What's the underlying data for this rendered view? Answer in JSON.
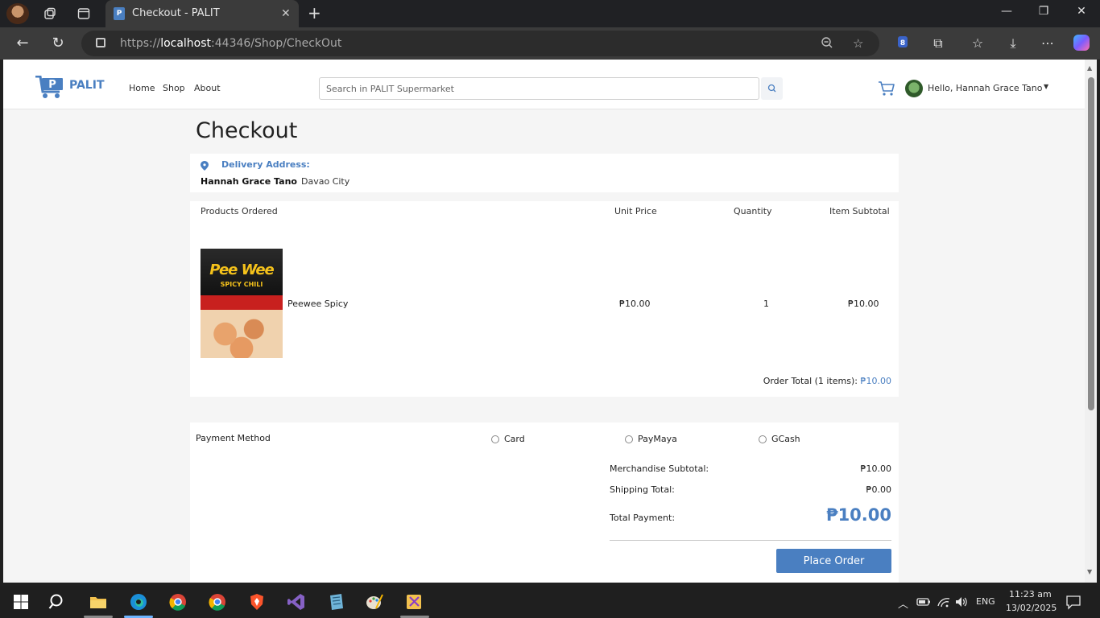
{
  "browser": {
    "tab_title": "Checkout - PALIT",
    "tab_favicon_letter": "P",
    "url_prefix": "https://",
    "url_host": "localhost",
    "url_rest": ":44346/Shop/CheckOut"
  },
  "site": {
    "logo_letter": "P",
    "logo_text": "PALIT",
    "nav": [
      "Home",
      "Shop",
      "About"
    ],
    "search_placeholder": "Search in PALIT Supermarket",
    "user_greeting": "Hello, Hannah Grace Tano",
    "brand_color": "#4a7fc1"
  },
  "checkout": {
    "title": "Checkout",
    "delivery": {
      "label": "Delivery Address:",
      "name": "Hannah Grace Tano",
      "city": "Davao City"
    },
    "columns": {
      "products": "Products Ordered",
      "unit_price": "Unit Price",
      "quantity": "Quantity",
      "subtotal": "Item Subtotal"
    },
    "item": {
      "name": "Peewee Spicy",
      "package_brand": "Pee Wee",
      "package_flavor": "SPICY CHILI",
      "unit_price": "₱10.00",
      "quantity": "1",
      "subtotal": "₱10.00"
    },
    "order_total_label": "Order Total (1 items):",
    "order_total_value": "₱10.00",
    "payment": {
      "label": "Payment Method",
      "options": [
        "Card",
        "PayMaya",
        "GCash"
      ]
    },
    "summary": {
      "merch_label": "Merchandise Subtotal:",
      "merch_value": "₱10.00",
      "ship_label": "Shipping Total:",
      "ship_value": "₱0.00",
      "total_label": "Total Payment:",
      "total_value": "₱10.00"
    },
    "place_order": "Place Order"
  },
  "taskbar": {
    "language": "ENG",
    "time": "11:23 am",
    "date": "13/02/2025"
  }
}
